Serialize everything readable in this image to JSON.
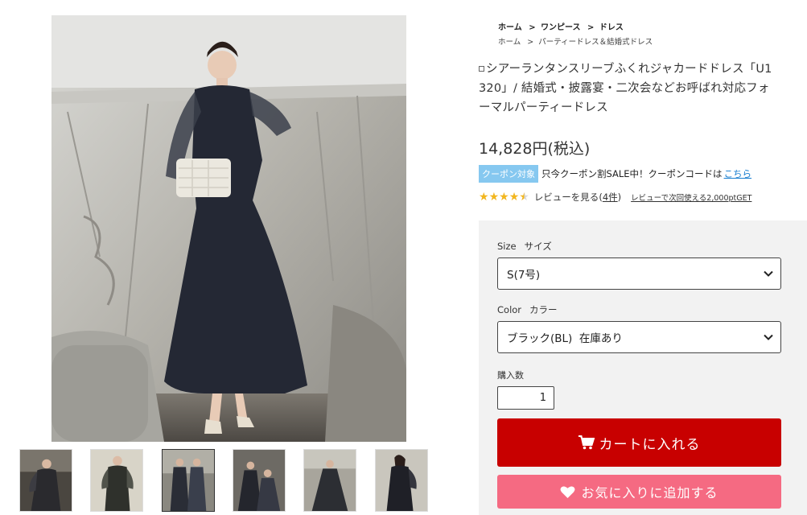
{
  "breadcrumbs": {
    "primary": [
      {
        "label": "ホーム"
      },
      {
        "label": "ワンピース"
      },
      {
        "label": "ドレス"
      }
    ],
    "secondary": [
      {
        "label": "ホーム"
      },
      {
        "label": "パーティードレス＆結婚式ドレス"
      }
    ],
    "separator": ">"
  },
  "product": {
    "title_line1": "シアーランタンスリーブふくれジャカードドレス「U1",
    "title_line2": "320」/ 結婚式・披露宴・二次会などお呼ばれ対応フォ",
    "title_line3": "ーマルパーティードレス",
    "price": "14,828円(税込)"
  },
  "coupon": {
    "badge": "クーポン対象",
    "text": "只今クーポン割SALE中！クーポンコードは",
    "link": "こちら"
  },
  "review": {
    "rating": 4.5,
    "link_text": "レビューを見る",
    "count": "4件",
    "points_text": "レビューで次回使える2,000ptGET"
  },
  "purchase": {
    "size_label": "Size",
    "size_sub": "サイズ",
    "size_value": "S(7号)",
    "color_label": "Color",
    "color_sub": "カラー",
    "color_value": "ブラック(BL)  在庫あり",
    "qty_label": "購入数",
    "qty_value": "1",
    "cart_button": "カートに入れる",
    "fav_button": "お気に入りに追加する"
  },
  "colors": {
    "cart": "#c80000",
    "favorite": "#f56a82",
    "coupon_badge": "#86c8f0",
    "link": "#1a7fd0",
    "star": "#f2b61e"
  },
  "icons": {
    "cart": "cart-icon",
    "favorite": "heart-icon",
    "select": "chevron-down-icon"
  }
}
